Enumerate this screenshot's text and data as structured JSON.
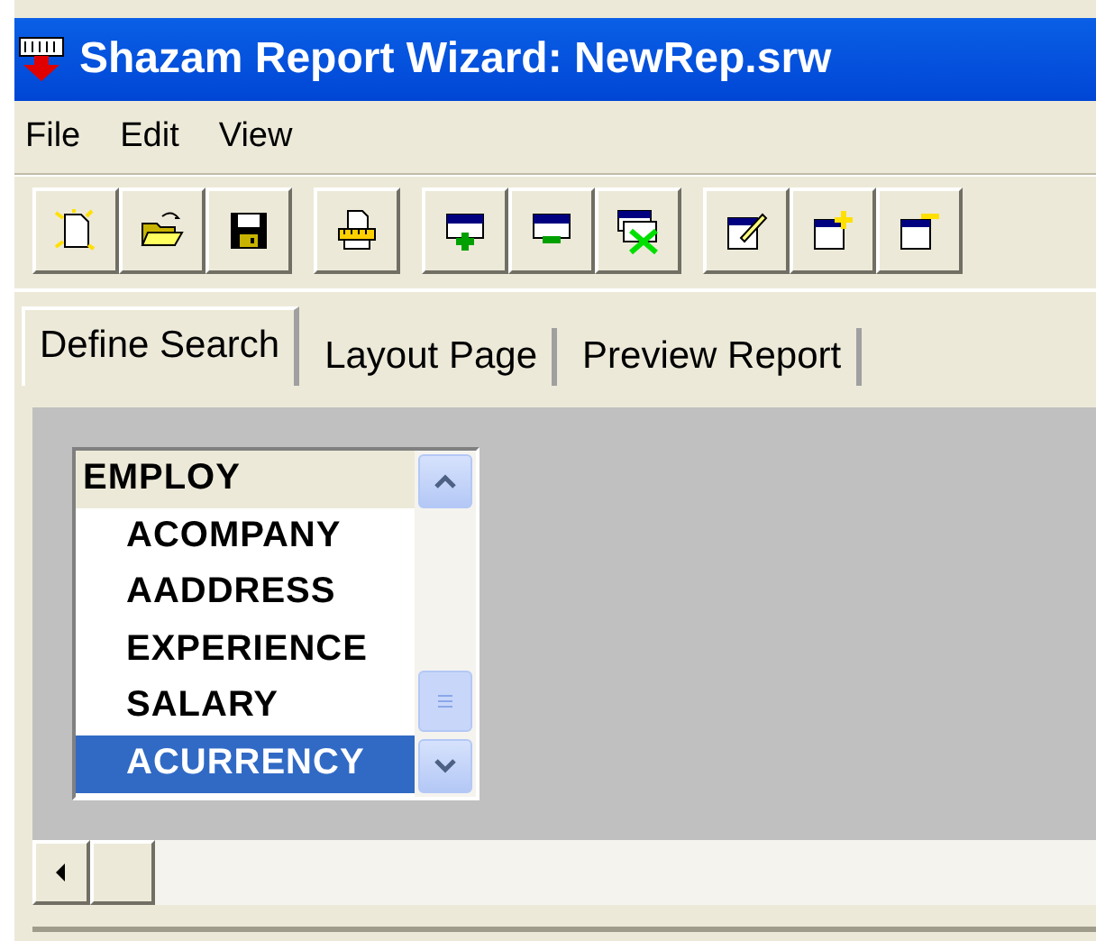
{
  "window": {
    "title": "Shazam Report Wizard: NewRep.srw"
  },
  "menu": [
    "File",
    "Edit",
    "View"
  ],
  "tabs": [
    {
      "label": "Define Search",
      "selected": true
    },
    {
      "label": "Layout Page",
      "selected": false
    },
    {
      "label": "Preview Report",
      "selected": false
    }
  ],
  "field_list": {
    "header": "EMPLOY",
    "items": [
      {
        "label": "ACOMPANY",
        "selected": false
      },
      {
        "label": "AADDRESS",
        "selected": false
      },
      {
        "label": "EXPERIENCE",
        "selected": false
      },
      {
        "label": "SALARY",
        "selected": false
      },
      {
        "label": "ACURRENCY",
        "selected": true
      }
    ]
  }
}
